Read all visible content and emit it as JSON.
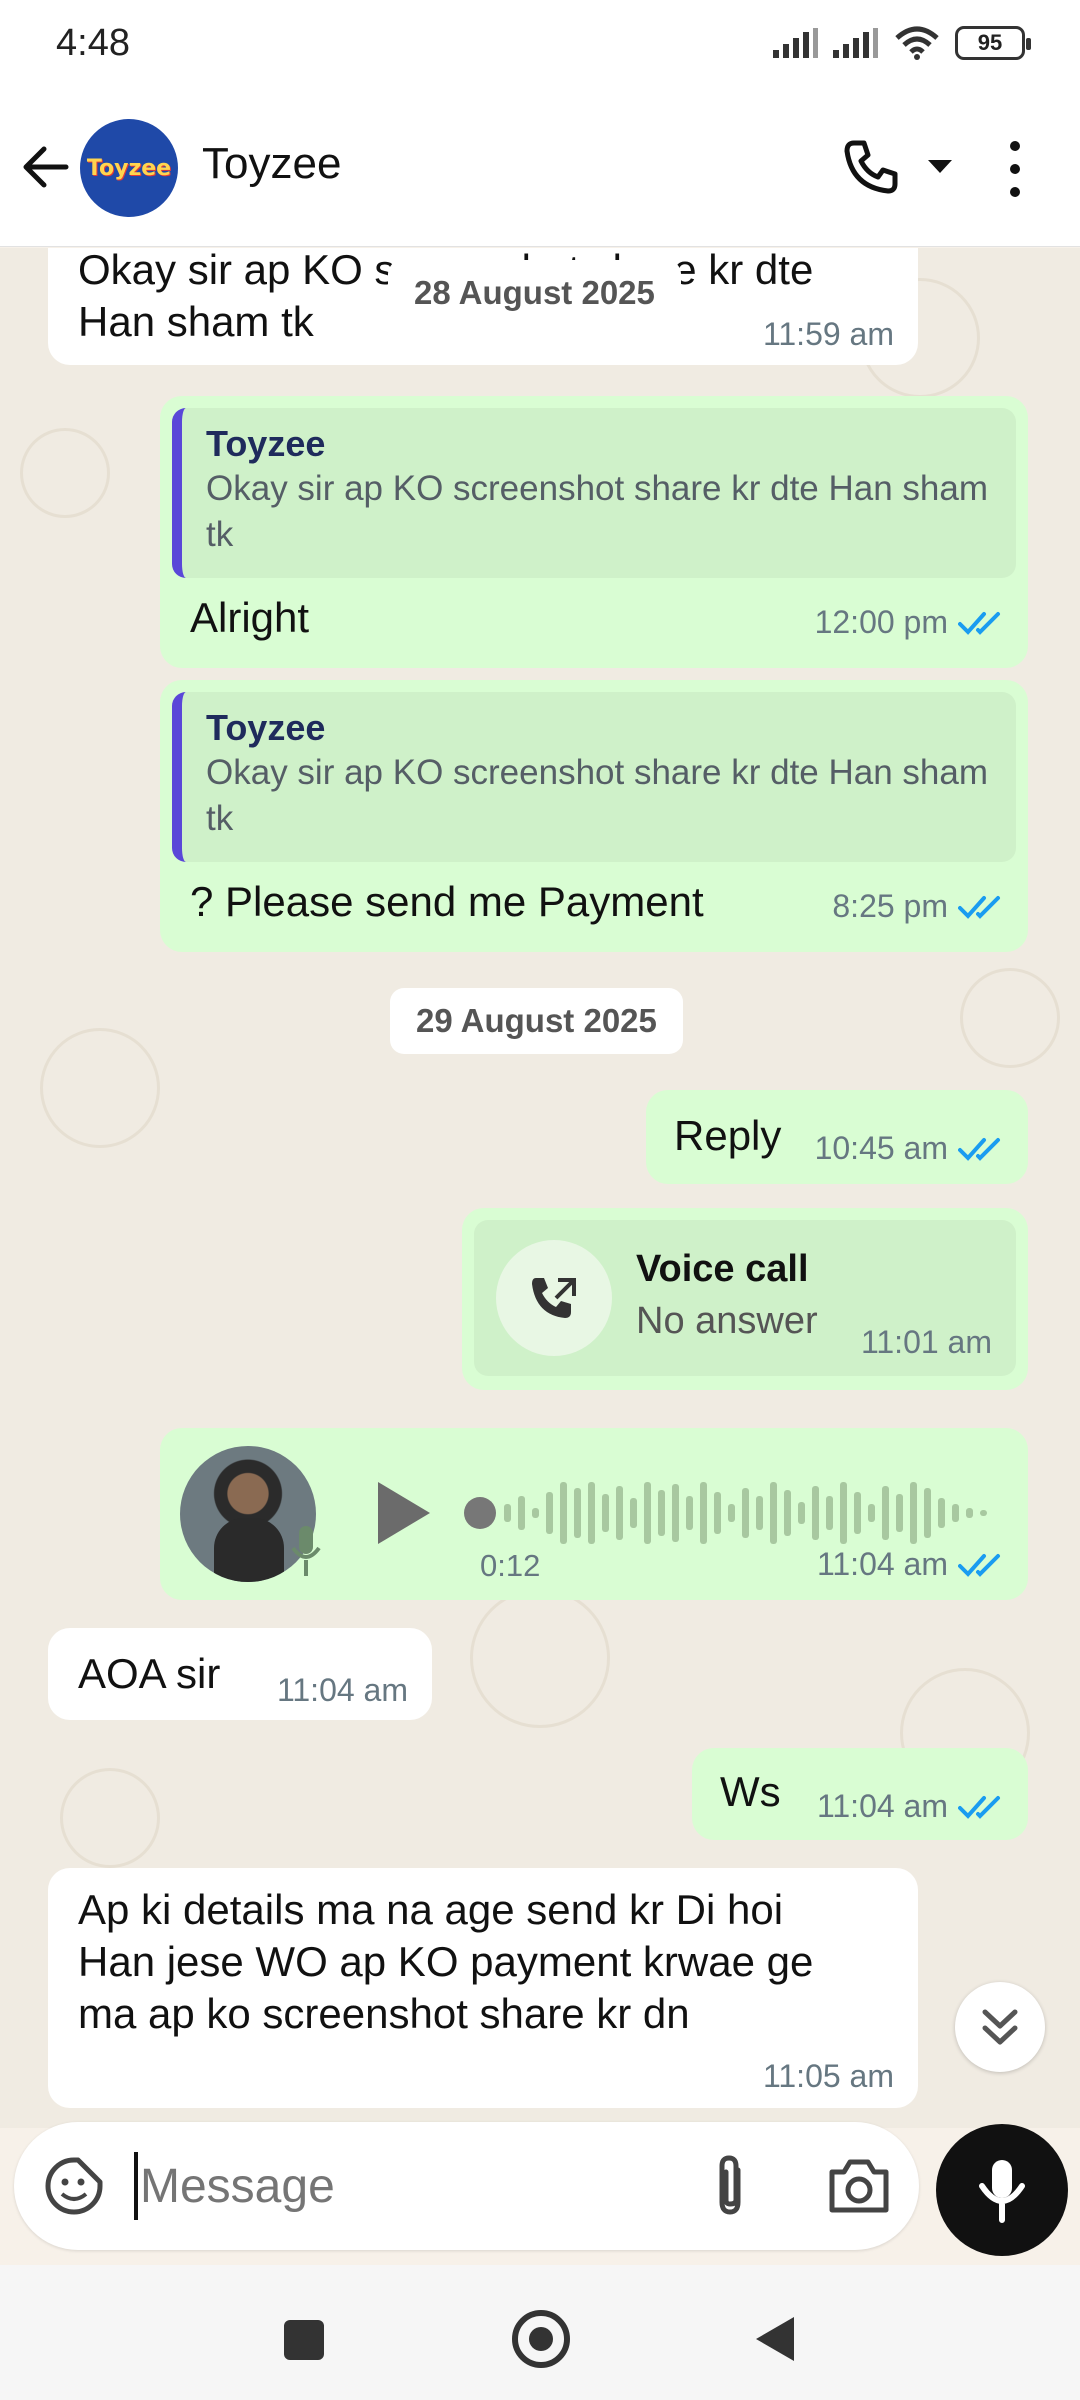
{
  "status_bar": {
    "time": "4:48",
    "battery": "95"
  },
  "header": {
    "contact_name": "Toyzee",
    "avatar_text": "Toyzee"
  },
  "messages": {
    "m1": {
      "text_line1": "Okay sir ap KO screenshot share kr dte",
      "text_line2": "Han sham tk",
      "time": "11:59 am"
    },
    "date1": "28 August 2025",
    "m2": {
      "quote_name": "Toyzee",
      "quote_text": "Okay sir ap KO screenshot share kr dte Han sham tk",
      "text": "Alright",
      "time": "12:00 pm"
    },
    "m3": {
      "quote_name": "Toyzee",
      "quote_text": "Okay sir ap KO screenshot share kr dte Han sham tk",
      "text": "? Please send me Payment",
      "time": "8:25 pm"
    },
    "date2": "29 August 2025",
    "m4": {
      "text": "Reply",
      "time": "10:45 am"
    },
    "m5": {
      "title": "Voice call",
      "subtitle": "No answer",
      "time": "11:01 am"
    },
    "m6": {
      "duration": "0:12",
      "time": "11:04 am"
    },
    "m7": {
      "text": "AOA sir",
      "time": "11:04 am"
    },
    "m8": {
      "text": "Ws",
      "time": "11:04 am"
    },
    "m9": {
      "line1": "Ap ki details ma na age send kr Di hoi",
      "line2": "Han jese WO ap KO payment krwae ge",
      "line3": "ma ap ko screenshot share kr dn",
      "time": "11:05 am"
    }
  },
  "composer": {
    "placeholder": "Message"
  },
  "colors": {
    "outgoing": "#d9fdd3",
    "incoming": "#ffffff",
    "read_ticks": "#1a9cf0",
    "quote_bar": "#5a47d8"
  }
}
